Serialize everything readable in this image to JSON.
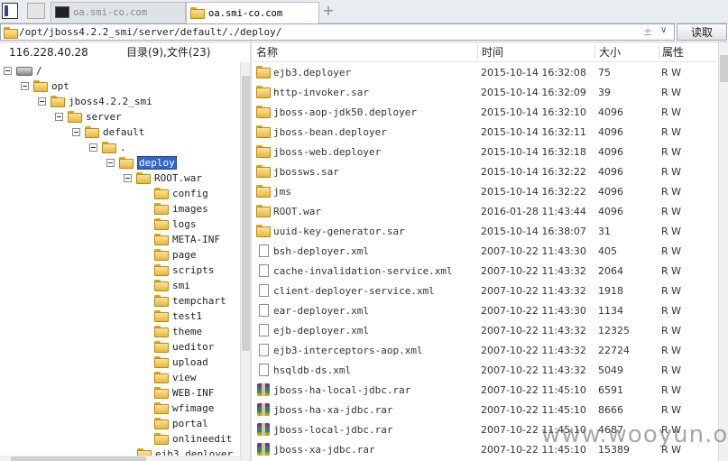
{
  "tabs": [
    {
      "label": "oa.smi-co.com",
      "icon": "terminal-icon"
    },
    {
      "label": "oa.smi-co.com",
      "icon": "folder-icon"
    }
  ],
  "address": {
    "path": "/opt/jboss4.2.2_smi/server/default/./deploy/",
    "read_button": "读取",
    "history_marker": "±"
  },
  "left_header": {
    "ip": "116.228.40.28",
    "summary": "目录(9),文件(23)"
  },
  "columns": {
    "name": "名称",
    "time": "时间",
    "size": "大小",
    "attr": "属性"
  },
  "tree": {
    "root": "/",
    "opt": "opt",
    "jboss": "jboss4.2.2_smi",
    "server": "server",
    "default": "default",
    "dot": ".",
    "deploy": "deploy",
    "rootwar": "ROOT.war",
    "subdirs": [
      "config",
      "images",
      "logs",
      "META-INF",
      "page",
      "scripts",
      "smi",
      "tempchart",
      "test1",
      "theme",
      "ueditor",
      "upload",
      "view",
      "WEB-INF",
      "wfimage",
      "portal",
      "onlineedit"
    ],
    "next": "ejb3.deployer"
  },
  "files": [
    {
      "type": "dir",
      "name": "ejb3.deployer",
      "time": "2015-10-14 16:32:08",
      "size": "75",
      "attr": "R W"
    },
    {
      "type": "dir",
      "name": "http-invoker.sar",
      "time": "2015-10-14 16:32:09",
      "size": "39",
      "attr": "R W"
    },
    {
      "type": "dir",
      "name": "jboss-aop-jdk50.deployer",
      "time": "2015-10-14 16:32:10",
      "size": "4096",
      "attr": "R W"
    },
    {
      "type": "dir",
      "name": "jboss-bean.deployer",
      "time": "2015-10-14 16:32:11",
      "size": "4096",
      "attr": "R W"
    },
    {
      "type": "dir",
      "name": "jboss-web.deployer",
      "time": "2015-10-14 16:32:18",
      "size": "4096",
      "attr": "R W"
    },
    {
      "type": "dir",
      "name": "jbossws.sar",
      "time": "2015-10-14 16:32:22",
      "size": "4096",
      "attr": "R W"
    },
    {
      "type": "dir",
      "name": "jms",
      "time": "2015-10-14 16:32:22",
      "size": "4096",
      "attr": "R W"
    },
    {
      "type": "dir",
      "name": "ROOT.war",
      "time": "2016-01-28 11:43:44",
      "size": "4096",
      "attr": "R W"
    },
    {
      "type": "dir",
      "name": "uuid-key-generator.sar",
      "time": "2015-10-14 16:38:07",
      "size": "31",
      "attr": "R W"
    },
    {
      "type": "doc",
      "name": "bsh-deployer.xml",
      "time": "2007-10-22 11:43:30",
      "size": "405",
      "attr": "R W"
    },
    {
      "type": "doc",
      "name": "cache-invalidation-service.xml",
      "time": "2007-10-22 11:43:32",
      "size": "2064",
      "attr": "R W"
    },
    {
      "type": "doc",
      "name": "client-deployer-service.xml",
      "time": "2007-10-22 11:43:32",
      "size": "1918",
      "attr": "R W"
    },
    {
      "type": "doc",
      "name": "ear-deployer.xml",
      "time": "2007-10-22 11:43:30",
      "size": "1134",
      "attr": "R W"
    },
    {
      "type": "doc",
      "name": "ejb-deployer.xml",
      "time": "2007-10-22 11:43:32",
      "size": "12325",
      "attr": "R W"
    },
    {
      "type": "doc",
      "name": "ejb3-interceptors-aop.xml",
      "time": "2007-10-22 11:43:32",
      "size": "22724",
      "attr": "R W"
    },
    {
      "type": "doc",
      "name": "hsqldb-ds.xml",
      "time": "2007-10-22 11:43:32",
      "size": "5049",
      "attr": "R W"
    },
    {
      "type": "rar",
      "name": "jboss-ha-local-jdbc.rar",
      "time": "2007-10-22 11:45:10",
      "size": "6591",
      "attr": "R W"
    },
    {
      "type": "rar",
      "name": "jboss-ha-xa-jdbc.rar",
      "time": "2007-10-22 11:45:10",
      "size": "8666",
      "attr": "R W"
    },
    {
      "type": "rar",
      "name": "jboss-local-jdbc.rar",
      "time": "2007-10-22 11:45:10",
      "size": "4687",
      "attr": "R W"
    },
    {
      "type": "rar",
      "name": "jboss-xa-jdbc.rar",
      "time": "2007-10-22 11:45:10",
      "size": "15389",
      "attr": "R W"
    }
  ],
  "watermark": "www.wooyun.org"
}
